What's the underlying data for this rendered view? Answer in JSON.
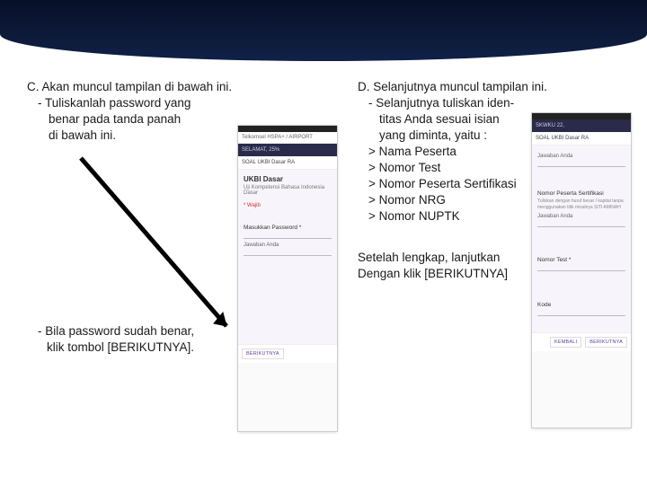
{
  "sectionC": {
    "heading": "C. Akan muncul tampilan di bawah ini.",
    "line1": "- Tuliskanlah password yang",
    "line2": "benar pada tanda panah",
    "line3": "di bawah ini.",
    "note1": "- Bila password sudah benar,",
    "note2": "klik tombol [BERIKUTNYA]."
  },
  "sectionD": {
    "heading": "D. Selanjutnya muncul tampilan ini.",
    "line1": "- Selanjutnya tuliskan iden-",
    "line2": "titas Anda sesuai isian",
    "line3": "yang diminta, yaitu :",
    "item1": "> Nama Peserta",
    "item2": "> Nomor Test",
    "item3": "> Nomor Peserta Sertifikasi",
    "item4": "> Nomor NRG",
    "item5": "> Nomor NUPTK",
    "after1": "Setelah lengkap, lanjutkan",
    "after2": "Dengan klik [BERIKUTNYA]"
  },
  "phoneC": {
    "carrier": "Telkomsel HSPA+ / AIRPORT",
    "banner": "SELAMAT, 25%",
    "section": "SOAL UKBI Dasar RA",
    "title": "UKBI Dasar",
    "subtitle": "Uji Kompetensi Bahasa Indonesia Dasar",
    "required": "* Wajib",
    "field": "Masukkan Password *",
    "answer": "Jawaban Anda",
    "btn": "BERIKUTNYA"
  },
  "phoneD": {
    "banner": "SKWKU 22,",
    "section": "SOAL UKBI Dasar RA",
    "answer": "Jawaban Anda",
    "f1": "Nomor Peserta Sertifikasi",
    "f1note": "Tuliskan dengan huruf besar / kapital tanpa menggunakan titik misalnya SITI AMINAH",
    "f2": "Nomor Test *",
    "f3": "Kode",
    "btnBack": "KEMBALI",
    "btnNext": "BERIKUTNYA"
  }
}
